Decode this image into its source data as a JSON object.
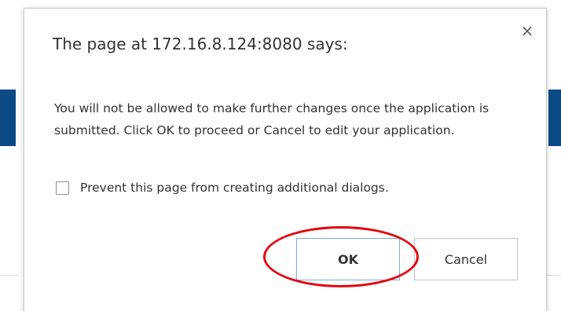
{
  "dialog": {
    "title": "The page at 172.16.8.124:8080 says:",
    "close_glyph": "×",
    "message": "You will not be allowed to make further changes once the application is submitted. Click OK to proceed or Cancel to edit your application.",
    "suppress_label": "Prevent this page from creating additional dialogs.",
    "suppress_checked": false,
    "ok_label": "OK",
    "cancel_label": "Cancel"
  },
  "annotation": {
    "highlighted_target": "ok-button",
    "color": "#e3060d"
  },
  "colors": {
    "background_band": "#0b4a84",
    "text": "#333333",
    "ok_border": "#7aa8e3"
  }
}
